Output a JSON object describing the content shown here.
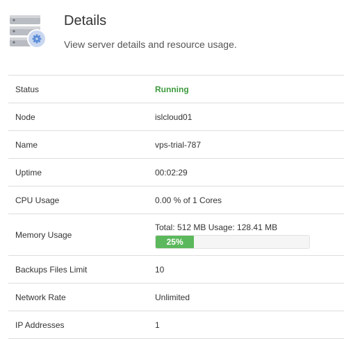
{
  "header": {
    "title": "Details",
    "subtitle": "View server details and resource usage."
  },
  "icon": {
    "name": "server-gear-icon",
    "accent": "#5b8dd9"
  },
  "rows": [
    {
      "label": "Status",
      "value": "Running",
      "value_color": "#3c9a3c"
    },
    {
      "label": "Node",
      "value": "islcloud01"
    },
    {
      "label": "Name",
      "value": "vps-trial-787"
    },
    {
      "label": "Uptime",
      "value": "00:02:29"
    },
    {
      "label": "CPU Usage",
      "value": "0.00 % of 1 Cores"
    },
    {
      "label": "Memory Usage",
      "value": "Total: 512 MB Usage: 128.41 MB",
      "progress_label": "25%",
      "progress_fraction": 0.25,
      "progress_color": "#5cb85c"
    },
    {
      "label": "Backups Files Limit",
      "value": "10"
    },
    {
      "label": "Network Rate",
      "value": "Unlimited"
    },
    {
      "label": "IP Addresses",
      "value": "1"
    }
  ]
}
